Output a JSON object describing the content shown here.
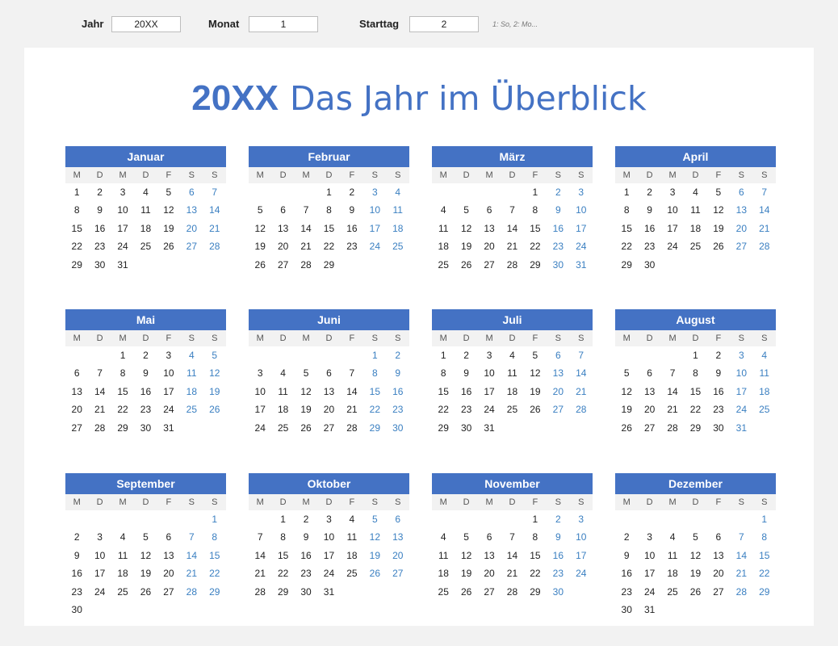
{
  "controls": {
    "year_label": "Jahr",
    "year_value": "20XX",
    "month_label": "Monat",
    "month_value": "1",
    "startday_label": "Starttag",
    "startday_value": "2",
    "startday_hint": "1: So, 2: Mo..."
  },
  "title": {
    "year": "20XX",
    "text": "Das Jahr im Überblick"
  },
  "weekdays": [
    "M",
    "D",
    "M",
    "D",
    "F",
    "S",
    "S"
  ],
  "colors": {
    "accent": "#4472c4",
    "weekend_text": "#3a7fc1",
    "weekday_row_bg": "#f2f2f2",
    "page_bg": "#f2f2f2",
    "sheet_bg": "#ffffff"
  },
  "months": [
    {
      "name": "Januar",
      "offset": 0,
      "days": 31
    },
    {
      "name": "Februar",
      "offset": 3,
      "days": 29
    },
    {
      "name": "März",
      "offset": 4,
      "days": 31
    },
    {
      "name": "April",
      "offset": 0,
      "days": 30
    },
    {
      "name": "Mai",
      "offset": 2,
      "days": 31
    },
    {
      "name": "Juni",
      "offset": 5,
      "days": 30
    },
    {
      "name": "Juli",
      "offset": 0,
      "days": 31
    },
    {
      "name": "August",
      "offset": 3,
      "days": 31
    },
    {
      "name": "September",
      "offset": 6,
      "days": 30
    },
    {
      "name": "Oktober",
      "offset": 1,
      "days": 31
    },
    {
      "name": "November",
      "offset": 4,
      "days": 30
    },
    {
      "name": "Dezember",
      "offset": 6,
      "days": 31
    }
  ]
}
